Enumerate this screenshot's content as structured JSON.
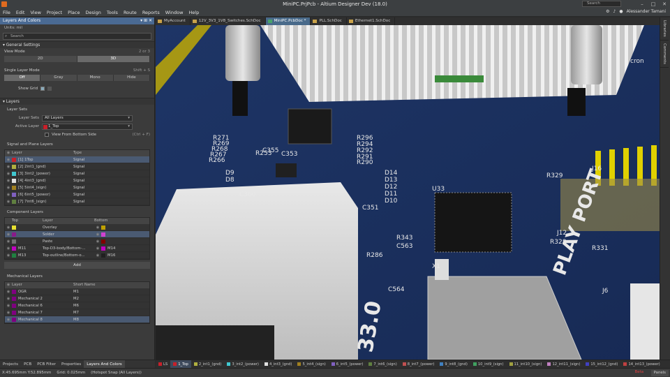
{
  "window": {
    "title": "MiniPC.PrjPcb - Altium Designer Dev (18.0)",
    "search_placeholder": "Search",
    "controls": [
      "–",
      "□",
      "✕"
    ]
  },
  "menu": {
    "items": [
      "File",
      "Edit",
      "View",
      "Project",
      "Place",
      "Design",
      "Tools",
      "Route",
      "Reports",
      "Window",
      "Help"
    ],
    "user": "Alessander Tamani"
  },
  "panel": {
    "title": "Layers And Colors",
    "header_icons": "▾ ⊞ ✕",
    "units": "Units: mil",
    "search_placeholder": "Search",
    "general": {
      "title": "General Settings",
      "view_mode_label": "View Mode",
      "view_mode_shortcut": "2 or 3",
      "view_modes": [
        "2D",
        "3D"
      ],
      "single_layer_label": "Single Layer Mode",
      "single_layer_shortcut": "Shift + S",
      "single_layer_modes": [
        "Off",
        "Gray",
        "Mono",
        "Hide"
      ],
      "show_grid_label": "Show Grid"
    },
    "layers": {
      "title": "Layers",
      "layer_sets_title": "Layer Sets",
      "layer_sets_label": "Layer Sets",
      "layer_sets_value": "All Layers",
      "active_layer_label": "Active Layer",
      "active_layer_value": "1_Top",
      "view_from_bottom_label": "View From Bottom Side",
      "view_from_bottom_shortcut": "(Ctrl + F)"
    },
    "signal": {
      "title": "Signal and Plane Layers",
      "col_layer": "Layer",
      "col_type": "Type",
      "rows": [
        {
          "name": "[1] 1Top",
          "type": "Signal",
          "color": "#c8202a"
        },
        {
          "name": "[2] 2int1_(gnd)",
          "type": "Signal",
          "color": "#b0b040"
        },
        {
          "name": "[3] 3int2_(power)",
          "type": "Signal",
          "color": "#40c8d0"
        },
        {
          "name": "[4] 4int3_(gnd)",
          "type": "Signal",
          "color": "#e0e0e0"
        },
        {
          "name": "[5] 5int4_(sign)",
          "type": "Signal",
          "color": "#a08020"
        },
        {
          "name": "[6] 6int5_(power)",
          "type": "Signal",
          "color": "#8060c0"
        },
        {
          "name": "[7] 7int6_(sign)",
          "type": "Signal",
          "color": "#608040"
        }
      ]
    },
    "component": {
      "title": "Component Layers",
      "col_top": "Top",
      "col_layer": "Layer",
      "col_bottom": "Bottom",
      "rows": [
        {
          "top": "",
          "name": "Overlay",
          "bottom": "",
          "tcolor": "#e8e030",
          "bcolor": "#c0a000"
        },
        {
          "top": "",
          "name": "Solder",
          "bottom": "",
          "tcolor": "#8a1a8a",
          "bcolor": "#d040d0"
        },
        {
          "top": "",
          "name": "Paste",
          "bottom": "",
          "tcolor": "#707070",
          "bcolor": "#800000"
        },
        {
          "top": "M11",
          "name": "Top-D3-body/Bottom-...",
          "bottom": "M14",
          "tcolor": "#c000c0",
          "bcolor": "#c000c0"
        },
        {
          "top": "M13",
          "name": "Top-outline/Bottom-o...",
          "bottom": "M16",
          "tcolor": "#208040",
          "bcolor": "#202020"
        }
      ],
      "add_label": "Add"
    },
    "mechanical": {
      "title": "Mechanical Layers",
      "col_layer": "Layer",
      "col_short": "Short Name",
      "rows": [
        {
          "name": "OGR",
          "short": "M1",
          "color": "#800080"
        },
        {
          "name": "Mechanical 2",
          "short": "M2",
          "color": "#800080"
        },
        {
          "name": "Mechanical 6",
          "short": "M6",
          "color": "#800080"
        },
        {
          "name": "Mechanical 7",
          "short": "M7",
          "color": "#800080"
        },
        {
          "name": "Mechanical 8",
          "short": "M8",
          "color": "#800080"
        }
      ]
    }
  },
  "panel_tabs": [
    "Projects",
    "PCB",
    "PCB Filter",
    "Properties",
    "Layers And Colors"
  ],
  "doc_tabs": [
    {
      "label": "MyAccount"
    },
    {
      "label": "12V_3V3_1V8_Switches.SchDoc"
    },
    {
      "label": "MiniPC.PcbDoc *"
    },
    {
      "label": "PLL.SchDoc"
    },
    {
      "label": "Ethernet1.SchDoc"
    }
  ],
  "right_strip": [
    "Libraries",
    "Comments"
  ],
  "board": {
    "labels": [
      "R271",
      "R269",
      "R268",
      "R267",
      "R266",
      "R253",
      "C355",
      "C353",
      "C360",
      "R296",
      "R294",
      "R292",
      "R291",
      "R290",
      "D14",
      "D13",
      "D12",
      "D11",
      "D10",
      "D9",
      "D8",
      "U33",
      "C351",
      "R343",
      "C563",
      "R286",
      "C564",
      "X1",
      "R329",
      "J12",
      "R328",
      "R331",
      "J6",
      "PLAY PORT",
      "33.0",
      "J16",
      "cron"
    ]
  },
  "layer_tabs": [
    {
      "label": "LS",
      "color": "#c8202a"
    },
    {
      "label": "1_Top",
      "color": "#c8202a"
    },
    {
      "label": "2_int1_(gnd)",
      "color": "#b0b040"
    },
    {
      "label": "3_int2_(power)",
      "color": "#40c8d0"
    },
    {
      "label": "4_int3_(gnd)",
      "color": "#e0e0e0"
    },
    {
      "label": "5_int4_(sign)",
      "color": "#a08020"
    },
    {
      "label": "6_int5_(power)",
      "color": "#8060c0"
    },
    {
      "label": "7_int6_(sign)",
      "color": "#608040"
    },
    {
      "label": "8_int7_(power)",
      "color": "#c05050"
    },
    {
      "label": "9_int8_(gnd)",
      "color": "#4080c0"
    },
    {
      "label": "10_int9_(sign)",
      "color": "#40a060"
    },
    {
      "label": "11_int10_(sign)",
      "color": "#a0a040"
    },
    {
      "label": "12_int11_(sign)",
      "color": "#c080c0"
    },
    {
      "label": "15_int12_(gnd)",
      "color": "#4040c0"
    },
    {
      "label": "14_int13_(power)",
      "color": "#c04040"
    }
  ],
  "status": {
    "coords": "X:45.695mm Y:52.895mm",
    "grid": "Grid: 0.025mm",
    "snap": "(Hotspot Snap (All Layers))",
    "warn": "Beta",
    "panels": "Panels"
  }
}
